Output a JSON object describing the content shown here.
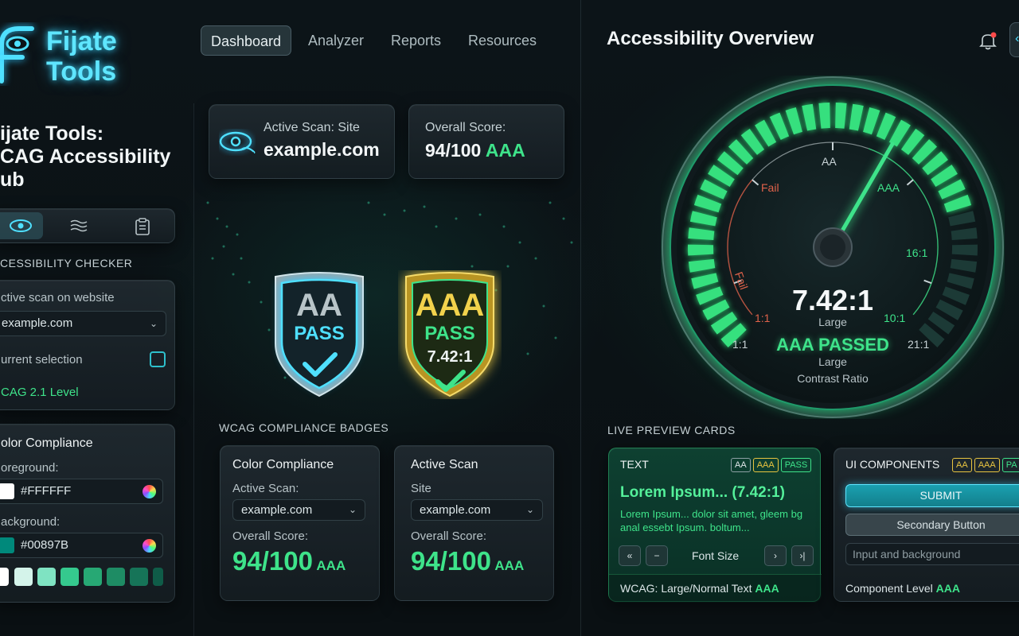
{
  "brand": {
    "name_line1": "Fijate",
    "name_line2": "Tools"
  },
  "nav": {
    "items": [
      "Dashboard",
      "Analyzer",
      "Reports",
      "Resources"
    ],
    "active": "Dashboard"
  },
  "sidebar": {
    "title_lines": [
      "ijate Tools:",
      "CAG Accessibility",
      "ub"
    ],
    "section_label": "CESSIBILITY CHECKER",
    "scan_label": "ctive scan on website",
    "scan_value": "example.com",
    "selection_label": "urrent selection",
    "level_label": "CAG 2.1 Level",
    "color_compliance_title": "olor Compliance",
    "foreground_label": "oreground:",
    "foreground_value": "#FFFFFF",
    "background_label": "ackground:",
    "background_value": "#00897B",
    "swatches": [
      "#ffffff",
      "#d4f3ea",
      "#7fe3c2",
      "#35c98e",
      "#27a874",
      "#1e8c64",
      "#167458",
      "#0f5c48"
    ]
  },
  "top_cards": {
    "active_scan_label": "Active Scan: Site",
    "active_scan_value": "example.com",
    "overall_label": "Overall Score:",
    "overall_value": "94/100",
    "overall_level": "AAA"
  },
  "badges": [
    {
      "level": "AA",
      "status": "PASS",
      "ratio": ""
    },
    {
      "level": "AAA",
      "status": "PASS",
      "ratio": "7.42:1"
    }
  ],
  "badges_section_label": "WCAG COMPLIANCE BADGES",
  "bottom_cards": [
    {
      "title": "Color Compliance",
      "field_label": "Active Scan:",
      "field_value": "example.com",
      "score_label": "Overall Score:",
      "score": "94/100",
      "level": "AAA"
    },
    {
      "title": "Active Scan",
      "field_label": "Site",
      "field_value": "example.com",
      "score_label": "Overall Score:",
      "score": "94/100",
      "level": "AAA"
    }
  ],
  "overview": {
    "title": "Accessibility Overview",
    "gauge": {
      "ratio": "7.42:1",
      "ratio_value": 7.42,
      "size_label": "Large",
      "result": "AAA PASSED",
      "result_size": "Large",
      "caption": "Contrast Ratio",
      "labels": [
        "AA",
        "AAA",
        "Fail",
        "Fail",
        "16:1",
        "10:1",
        "1:1",
        "1:1",
        "21:1"
      ]
    }
  },
  "live_preview": {
    "section_label": "LIVE PREVIEW CARDS",
    "text_card": {
      "title": "TEXT",
      "badges": [
        "AA",
        "AAA",
        "PASS"
      ],
      "heading": "Lorem Ipsum... (7.42:1)",
      "body": "Lorem Ipsum... dolor sit amet, gleem bg anal essebt Ipsum. boltum...",
      "font_size_label": "Font Size",
      "first_icon": "«",
      "minus_icon": "−",
      "next_icon": "›",
      "last_icon": "›|",
      "footer": "WCAG: Large/Normal Text",
      "footer_level": "AAA"
    },
    "ui_card": {
      "title": "UI COMPONENTS",
      "badges": [
        "AA",
        "AAA",
        "PA"
      ],
      "submit_label": "SUBMIT",
      "secondary_label": "Secondary Button",
      "input_placeholder": "Input and background",
      "footer": "Component Level",
      "footer_level": "AAA"
    }
  },
  "colors": {
    "accent": "#3ee38a",
    "cyan": "#4fe0ff",
    "gold": "#e8c440",
    "bg": "#0b1216"
  }
}
